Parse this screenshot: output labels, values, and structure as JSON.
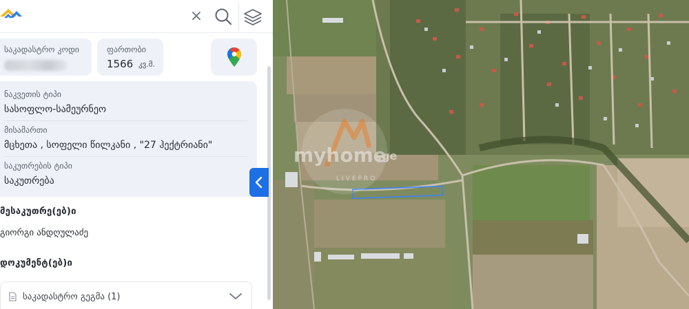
{
  "header": {
    "close_icon": "×",
    "logo_icon": "myhome-logo-icon",
    "search_icon": "search-icon",
    "layers_icon": "layers-icon"
  },
  "parcel": {
    "cadastral_code_label": "საკადასტრო კოდი",
    "area_label": "ფართობი",
    "area_value": "1566",
    "area_unit": "კვ.მ.",
    "maps_icon": "google-maps-pin-icon"
  },
  "details": [
    {
      "label": "ნაკვეთის ტიპი",
      "value": "სასოფლო-სამეურნეო"
    },
    {
      "label": "მისამართი",
      "value": "მცხეთა , სოფელი წილკანი , \"27 ჰექტრიანი\""
    },
    {
      "label": "საკუთრების ტიპი",
      "value": "საკუთრება"
    }
  ],
  "owners": {
    "title": "მესაკუთრე(ებ)ი",
    "name": "გიორგი ანდღულაძე"
  },
  "documents": {
    "title": "დოკუმენტ(ებ)ი",
    "item_label": "საკადასტრო გეგმა (1)"
  },
  "map": {
    "watermark_brand": "myhome",
    "watermark_tld": ".ge",
    "watermark_sub": "LIVEPRO"
  },
  "colors": {
    "accent_blue": "#1d6fe4",
    "card_bg": "#eef2f8",
    "parcel_outline": "#3a82ff",
    "watermark_orange": "#f08a3c"
  }
}
